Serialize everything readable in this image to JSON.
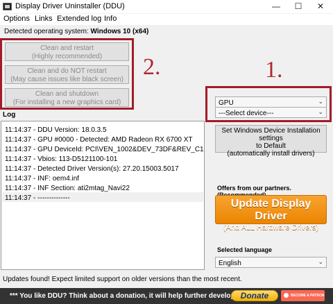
{
  "window": {
    "title": "Display Driver Uninstaller (DDU)",
    "app_icon": "ddu-app-icon",
    "controls": {
      "minimize": "—",
      "maximize": "☐",
      "close": "✕"
    }
  },
  "menu": [
    "Options",
    "Links",
    "Extended log",
    "Info"
  ],
  "detected_os": {
    "label": "Detected operating system: ",
    "value": "Windows 10 (x64)"
  },
  "actions": {
    "clean_restart": {
      "line1": "Clean and restart",
      "line2": "(Highly recommended)"
    },
    "clean_no_restart": {
      "line1": "Clean and do NOT restart",
      "line2": "(May cause issues like black screen)"
    },
    "clean_shutdown": {
      "line1": "Clean and shutdown",
      "line2": "(For installing a new graphics card)"
    }
  },
  "annotations": {
    "step1": "1.",
    "step2": "2.",
    "color": "#b0282f"
  },
  "device_type": {
    "selected": "GPU"
  },
  "device": {
    "selected": "---Select device---"
  },
  "log": {
    "label": "Log",
    "lines": [
      "11:14:37 - DDU Version: 18.0.3.5",
      "11:14:37 - GPU #0000 - Detected: AMD Radeon RX 6700 XT",
      "11:14:37 - GPU DeviceId: PCI\\VEN_1002&DEV_73DF&REV_C1",
      "11:14:37 - Vbios: 113-D5121100-101",
      "11:14:37 - Detected Driver Version(s): 27.20.15003.5017",
      "11:14:37 - INF: oem4.inf",
      "11:14:37 - INF Section: ati2mtag_Navi22",
      "11:14:37 - --------------"
    ]
  },
  "windows_update_button": {
    "line1": "Set Windows Device Installation settings",
    "line2": "to Default",
    "line3": "(automatically install drivers)"
  },
  "partners": {
    "label": "Offers from our partners. (Recommended)",
    "update_main": "Update Display Driver",
    "update_sub": "(And ALL Hardware Drivers)"
  },
  "language": {
    "label": "Selected language",
    "selected": "English"
  },
  "status_text": "Updates found! Expect limited support on older versions than the most recent.",
  "footer": {
    "message": "*** You like DDU? Think about a donation, it will help further development. ***",
    "donate_label": "Donate",
    "patreon_label": "BECOME A PATRON"
  },
  "colors": {
    "accent_orange": "#f39317",
    "annotation_red": "#a01c28",
    "footer_bg": "#333333"
  }
}
